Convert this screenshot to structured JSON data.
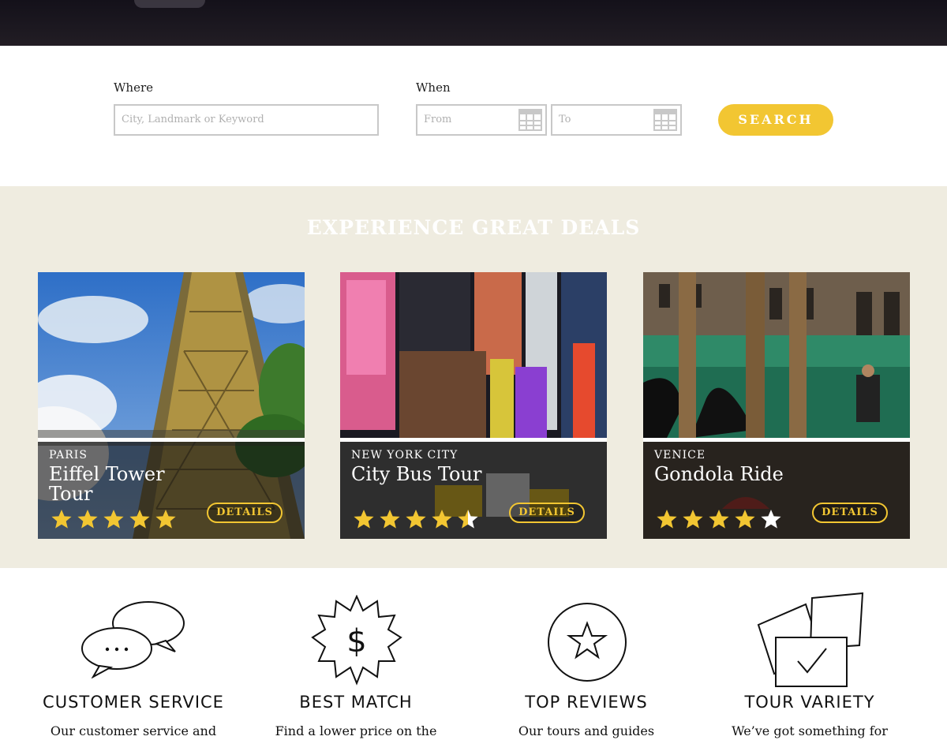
{
  "search": {
    "where_label": "Where",
    "where_placeholder": "City, Landmark or Keyword",
    "when_label": "When",
    "from_placeholder": "From",
    "to_placeholder": "To",
    "search_button": "SEARCH"
  },
  "deals": {
    "title": "EXPERIENCE GREAT DEALS",
    "details_label": "DETAILS",
    "cards": [
      {
        "city": "PARIS",
        "name": "Eiffel Tower Tour",
        "rating": 5
      },
      {
        "city": "NEW YORK CITY",
        "name": "City Bus Tour",
        "rating": 4.5
      },
      {
        "city": "VENICE",
        "name": "Gondola Ride",
        "rating": 4
      }
    ]
  },
  "features": [
    {
      "icon": "chat-bubbles-icon",
      "title": "CUSTOMER SERVICE",
      "text": "Our customer service and"
    },
    {
      "icon": "price-badge-icon",
      "title": "BEST MATCH",
      "text": "Find a lower price on the"
    },
    {
      "icon": "star-circle-icon",
      "title": "TOP REVIEWS",
      "text": "Our tours and guides"
    },
    {
      "icon": "checklist-cards-icon",
      "title": "TOUR VARIETY",
      "text": "We’ve got something for"
    }
  ],
  "colors": {
    "accent": "#f2c632",
    "deals_bg": "#efece0",
    "hero": "#1c1820"
  }
}
